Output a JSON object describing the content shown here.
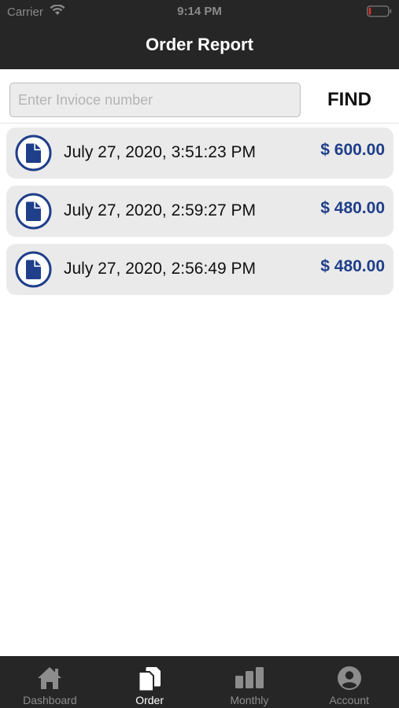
{
  "status_bar": {
    "carrier": "Carrier",
    "time": "9:14 PM"
  },
  "header": {
    "title": "Order Report"
  },
  "search": {
    "placeholder": "Enter Invioce number",
    "value": "",
    "find_label": "FIND"
  },
  "orders": [
    {
      "date": "July 27, 2020, 3:51:23 PM",
      "amount": "$ 600.00",
      "icon": "document-icon"
    },
    {
      "date": "July 27, 2020, 2:59:27 PM",
      "amount": "$ 480.00",
      "icon": "document-icon"
    },
    {
      "date": "July 27, 2020, 2:56:49 PM",
      "amount": "$ 480.00",
      "icon": "document-icon"
    }
  ],
  "tab_bar": {
    "active_tab": "Order",
    "tabs": [
      {
        "label": "Dashboard",
        "icon": "home-icon"
      },
      {
        "label": "Order",
        "icon": "documents-icon"
      },
      {
        "label": "Monthly",
        "icon": "bar-chart-icon"
      },
      {
        "label": "Account",
        "icon": "account-icon"
      }
    ]
  },
  "colors": {
    "header_bg": "#262626",
    "accent": "#1f3f8a",
    "card_bg": "#eaeaea",
    "battery_level": "#d9322b"
  }
}
